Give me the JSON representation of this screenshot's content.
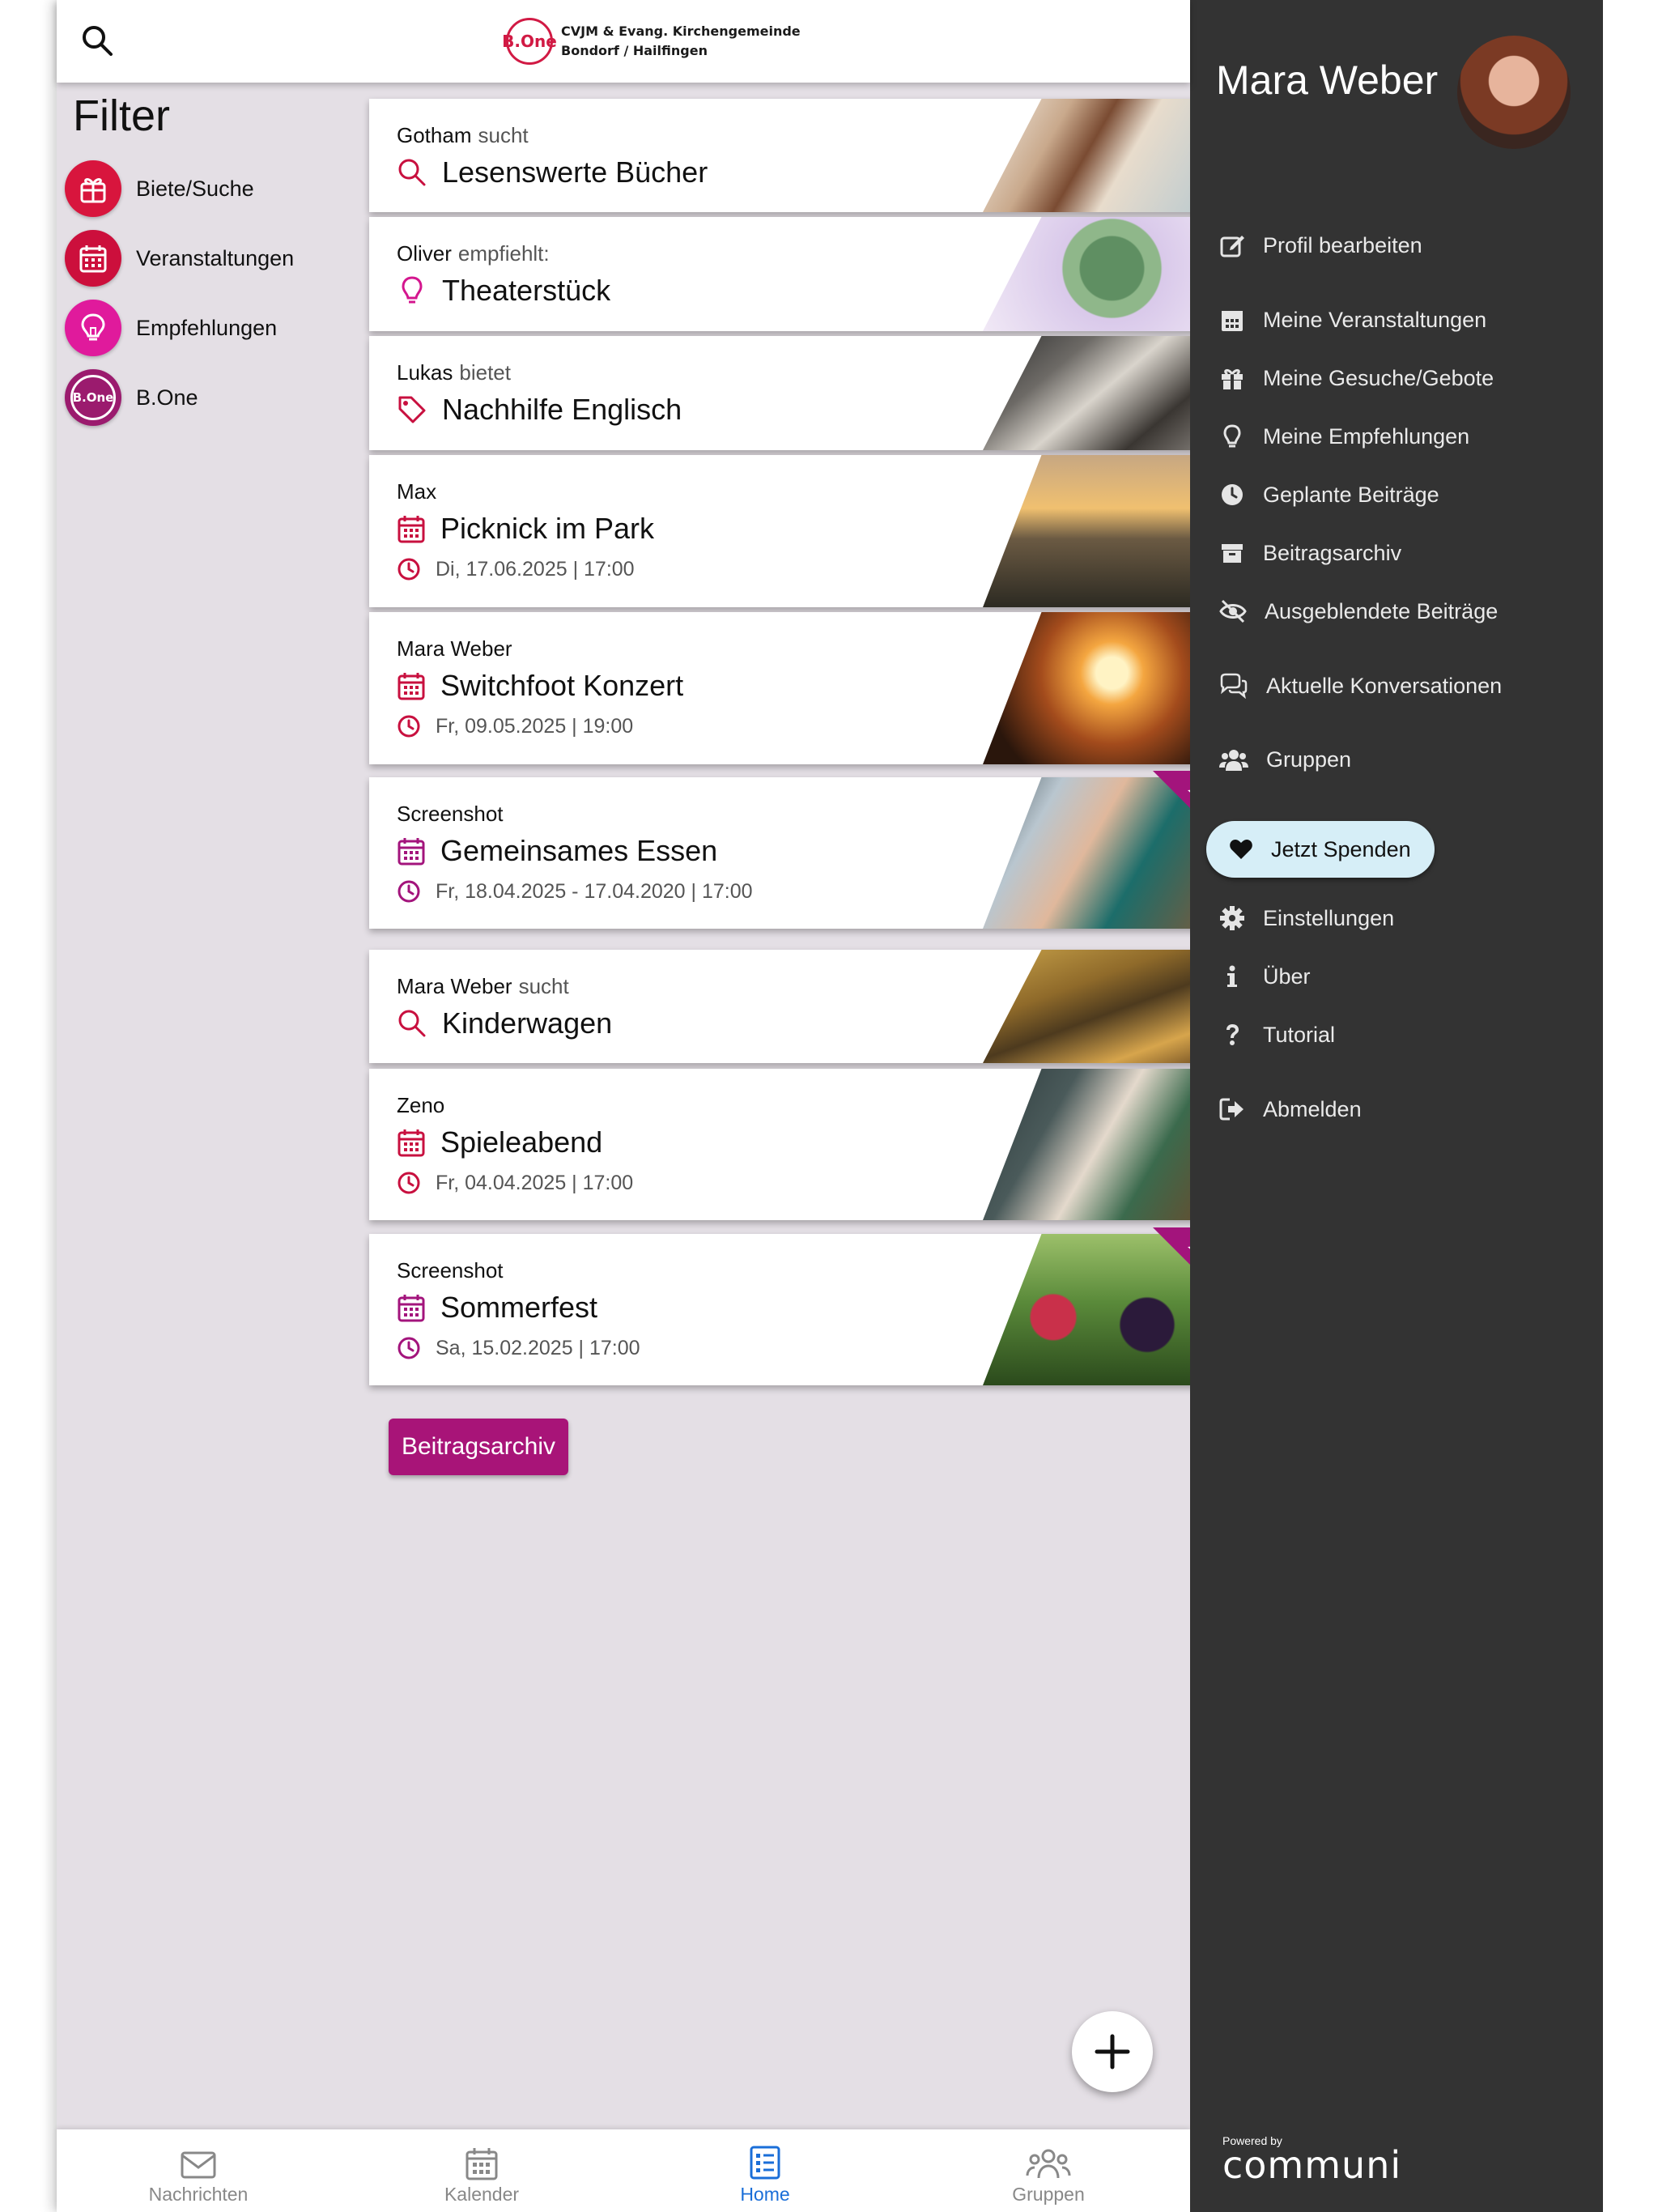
{
  "header": {
    "logo_badge": "B.One",
    "logo_line1": "CVJM & Evang. Kirchengemeinde",
    "logo_line2": "Bondorf / Hailfingen"
  },
  "filter": {
    "title": "Filter",
    "items": [
      {
        "label": "Biete/Suche",
        "icon": "gift-icon",
        "color": "#d8153d"
      },
      {
        "label": "Veranstaltungen",
        "icon": "calendar-icon",
        "color": "#cc0f3c"
      },
      {
        "label": "Empfehlungen",
        "icon": "lightbulb-icon",
        "color": "#e01a9c"
      },
      {
        "label": "B.One",
        "icon": "bone-logo-icon",
        "color": "#9b1b6e"
      }
    ]
  },
  "feed": {
    "cards": [
      {
        "author": "Gotham",
        "verb": "sucht",
        "title": "Lesenswerte Bücher",
        "icon": "search-icon"
      },
      {
        "author": "Oliver",
        "verb": "empfiehlt:",
        "title": "Theaterstück",
        "icon": "lightbulb-icon"
      },
      {
        "author": "Lukas",
        "verb": "bietet",
        "title": "Nachhilfe Englisch",
        "icon": "tag-icon"
      },
      {
        "author": "Max",
        "verb": "",
        "title": "Picknick im Park",
        "date": "Di, 17.06.2025 | 17:00",
        "icon": "calendar-icon"
      },
      {
        "author": "Mara Weber",
        "verb": "",
        "title": "Switchfoot Konzert",
        "date": "Fr, 09.05.2025 | 19:00",
        "icon": "calendar-icon"
      },
      {
        "author": "Screenshot",
        "verb": "",
        "title": "Gemeinsames Essen",
        "date": "Fr, 18.04.2025 - 17.04.2020 | 17:00",
        "icon": "calendar-icon",
        "featured": true
      },
      {
        "author": "Mara Weber",
        "verb": "sucht",
        "title": "Kinderwagen",
        "icon": "search-icon"
      },
      {
        "author": "Zeno",
        "verb": "",
        "title": "Spieleabend",
        "date": "Fr, 04.04.2025 | 17:00",
        "icon": "calendar-icon"
      },
      {
        "author": "Screenshot",
        "verb": "",
        "title": "Sommerfest",
        "date": "Sa, 15.02.2025 | 17:00",
        "icon": "calendar-icon",
        "featured": true
      }
    ],
    "archive_button": "Beitragsarchiv"
  },
  "bottom_nav": [
    {
      "label": "Nachrichten",
      "icon": "envelope-icon"
    },
    {
      "label": "Kalender",
      "icon": "calendar-icon"
    },
    {
      "label": "Home",
      "icon": "list-icon",
      "active": true
    },
    {
      "label": "Gruppen",
      "icon": "people-icon"
    }
  ],
  "drawer": {
    "user_name": "Mara Weber",
    "menu": [
      {
        "label": "Profil bearbeiten",
        "icon": "edit-icon"
      },
      {
        "label": "Meine Veranstaltungen",
        "icon": "calendar-icon"
      },
      {
        "label": "Meine Gesuche/Gebote",
        "icon": "gift-icon"
      },
      {
        "label": "Meine Empfehlungen",
        "icon": "lightbulb-icon"
      },
      {
        "label": "Geplante Beiträge",
        "icon": "clock-icon"
      },
      {
        "label": "Beitragsarchiv",
        "icon": "archive-icon"
      },
      {
        "label": "Ausgeblendete Beiträge",
        "icon": "eye-slash-icon"
      },
      {
        "label": "Aktuelle Konversationen",
        "icon": "chat-icon"
      },
      {
        "label": "Gruppen",
        "icon": "users-icon"
      },
      {
        "label": "Einstellungen",
        "icon": "gear-icon"
      },
      {
        "label": "Über",
        "icon": "info-icon"
      },
      {
        "label": "Tutorial",
        "icon": "question-icon"
      },
      {
        "label": "Abmelden",
        "icon": "logout-icon"
      }
    ],
    "donate_label": "Jetzt Spenden",
    "powered_by": "Powered by",
    "brand": "communi"
  },
  "colors": {
    "accent": "#a81478",
    "event_red": "#c8103f",
    "drawer_bg": "#333333",
    "feed_bg": "#e4dfe5",
    "active_tab": "#1a6ed8"
  }
}
